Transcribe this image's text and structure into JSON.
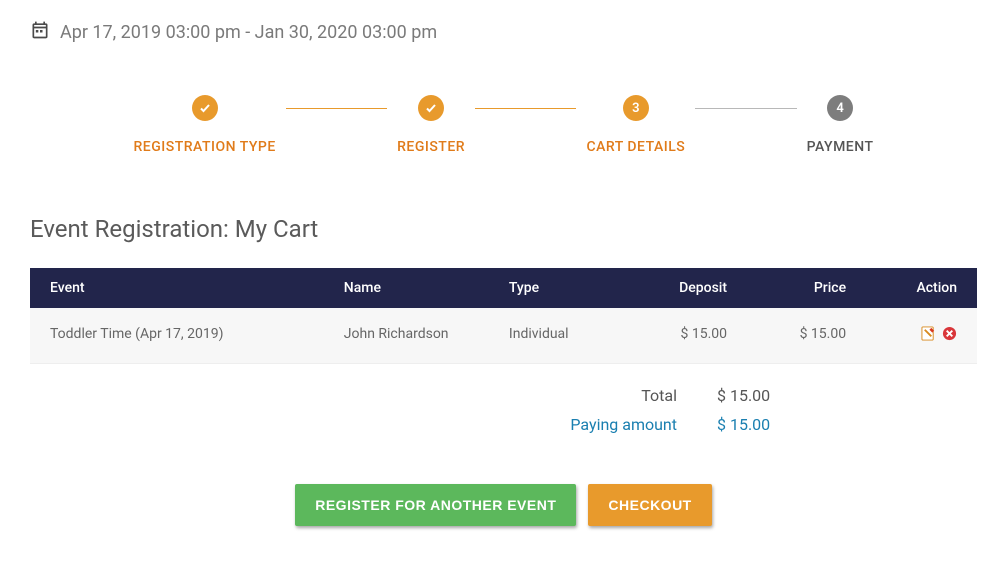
{
  "date_range": "Apr 17, 2019 03:00 pm - Jan 30, 2020 03:00 pm",
  "steps": [
    {
      "label": "REGISTRATION TYPE",
      "state": "done"
    },
    {
      "label": "REGISTER",
      "state": "done"
    },
    {
      "label": "CART DETAILS",
      "state": "current",
      "num": "3"
    },
    {
      "label": "PAYMENT",
      "state": "upcoming",
      "num": "4"
    }
  ],
  "page_title": "Event Registration: My Cart",
  "table": {
    "headers": {
      "event": "Event",
      "name": "Name",
      "type": "Type",
      "deposit": "Deposit",
      "price": "Price",
      "action": "Action"
    },
    "rows": [
      {
        "event": "Toddler Time (Apr 17, 2019)",
        "name": "John Richardson",
        "type": "Individual",
        "deposit": "$ 15.00",
        "price": "$ 15.00"
      }
    ]
  },
  "totals": {
    "total_label": "Total",
    "total_value": "$ 15.00",
    "paying_label": "Paying amount",
    "paying_value": "$ 15.00"
  },
  "buttons": {
    "register_another": "REGISTER FOR ANOTHER EVENT",
    "checkout": "CHECKOUT"
  }
}
